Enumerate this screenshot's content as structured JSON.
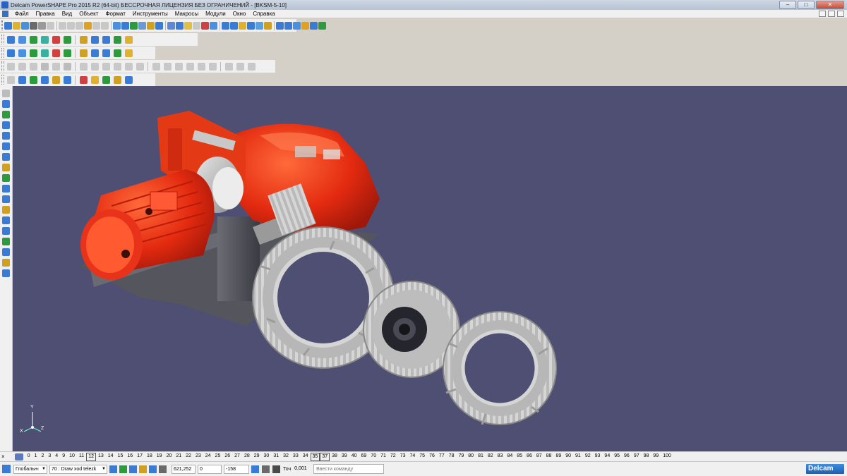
{
  "window": {
    "title": "Delcam PowerSHAPE Pro 2015 R2 (64-bit) БЕССРОЧНАЯ ЛИЦЕНЗИЯ БЕЗ ОГРАНИЧЕНИЙ - [BKSM-5-10]",
    "minimize": "–",
    "maximize": "□",
    "close": "✕"
  },
  "menu": {
    "items": [
      "Файл",
      "Правка",
      "Вид",
      "Объект",
      "Формат",
      "Инструменты",
      "Макросы",
      "Модули",
      "Окно",
      "Справка"
    ]
  },
  "toolbar_colors": {
    "row1": [
      "#3a7bd5",
      "#e0b030",
      "#4a8fdc",
      "#6a6a6a",
      "#9a9a9a",
      "#c8c8c8",
      "#c8c8c8",
      "#c8c8c8",
      "#c8c8c8",
      "#e0a020",
      "#c8c8c8",
      "#c8c8c8",
      "#4a90e2",
      "#3a7bd5",
      "#2e9a3e",
      "#6a9ad5",
      "#d0a020",
      "#3a7bd5",
      "#5a8ad5",
      "#3a7bd5",
      "#e0c040",
      "#c8c8c8",
      "#d04040",
      "#4a90e2",
      "#3a7bd5",
      "#3a7bd5",
      "#e0b030",
      "#3a7bd5",
      "#5aa0e0",
      "#d0a020",
      "#3a7bd5",
      "#3a7bd5",
      "#4a90e2",
      "#e0a020",
      "#3a7bd5",
      "#2e9a3e"
    ],
    "row2": [
      "#3a7bd5",
      "#4a90e2",
      "#2e9a3e",
      "#3ab0a0",
      "#d04040",
      "#2e9a3e",
      "#d0a020",
      "#3a7bd5",
      "#3a7bd5",
      "#2e9a3e",
      "#e0b030"
    ],
    "row3": [
      "#c8c8c8",
      "#c8c8c8",
      "#c8c8c8",
      "#bcbcbc",
      "#c8c8c8",
      "#bcbcbc",
      "#c8c8c8",
      "#c8c8c8",
      "#c8c8c8",
      "#c8c8c8",
      "#c8c8c8",
      "#c8c8c8",
      "#c8c8c8",
      "#c8c8c8",
      "#c8c8c8",
      "#c8c8c8",
      "#c8c8c8",
      "#c8c8c8",
      "#c8c8c8",
      "#c8c8c8",
      "#c8c8c8"
    ],
    "row4": [
      "#c8c8c8",
      "#3a7bd5",
      "#2e9a3e",
      "#3a7bd5",
      "#d0a020",
      "#3a7bd5",
      "#d04040",
      "#e0b030",
      "#2e9a3e",
      "#d0a020",
      "#3a7bd5"
    ],
    "left": [
      "#bcbcbc",
      "#3a7bd5",
      "#2e9a3e",
      "#3a7bd5",
      "#3a7bd5",
      "#3a7bd5",
      "#3a7bd5",
      "#d0a020",
      "#2e9a3e",
      "#3a7bd5",
      "#3a7bd5",
      "#d0a020",
      "#3a7bd5",
      "#3a7bd5",
      "#2e9a3e",
      "#3a7bd5",
      "#d0a020",
      "#3a7bd5"
    ]
  },
  "viewport": {
    "background": "#4f4f73",
    "axes": {
      "x": "X",
      "y": "Y",
      "z": "Z"
    }
  },
  "levels": {
    "items": [
      "0",
      "1",
      "2",
      "3",
      "4",
      "9",
      "10",
      "11",
      "12",
      "13",
      "14",
      "15",
      "16",
      "17",
      "18",
      "19",
      "20",
      "21",
      "22",
      "23",
      "24",
      "25",
      "26",
      "27",
      "28",
      "29",
      "30",
      "31",
      "32",
      "33",
      "34",
      "35",
      "37",
      "38",
      "39",
      "40",
      "69",
      "70",
      "71",
      "72",
      "73",
      "74",
      "75",
      "76",
      "77",
      "78",
      "79",
      "80",
      "81",
      "82",
      "83",
      "84",
      "85",
      "86",
      "87",
      "88",
      "89",
      "90",
      "91",
      "92",
      "93",
      "94",
      "95",
      "96",
      "97",
      "98",
      "99",
      "100"
    ],
    "boxed": [
      "12",
      "35",
      "37"
    ]
  },
  "status": {
    "workplane": "Глобальн‹",
    "level_combo": "70 : Draw xod telezk",
    "x": "621,252",
    "y": "0",
    "z": "-158",
    "tolerance_label": "Точ",
    "tolerance": "0,001",
    "command_placeholder": "Ввести команду",
    "brand": "Delcam"
  }
}
